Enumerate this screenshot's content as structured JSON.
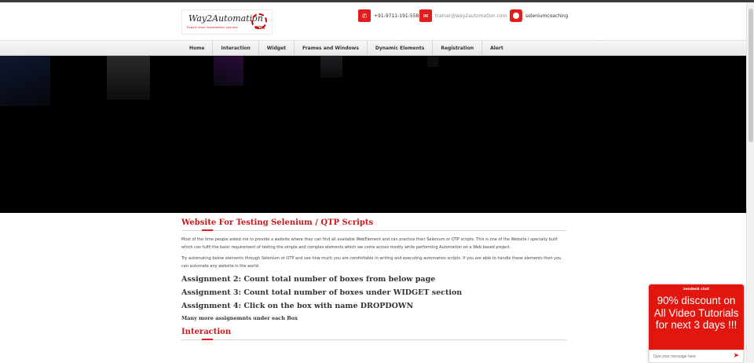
{
  "header": {
    "logo": {
      "brand": "Way2Automation",
      "tagline": "Expert level Automation courses",
      "mark": "W2A"
    },
    "contacts": [
      {
        "icon": "phone-icon",
        "text": "+91-9711-191-558"
      },
      {
        "icon": "envelope-icon",
        "text": "trainer@way2automation.com"
      },
      {
        "icon": "skype-icon",
        "text": "seleniumcoaching"
      }
    ]
  },
  "nav": {
    "items": [
      "Home",
      "Interaction",
      "Widget",
      "Frames and Windows",
      "Dynamic Elements",
      "Registration",
      "Alert"
    ]
  },
  "main": {
    "title": "Website For Testing Selenium / QTP Scripts",
    "para1": "Most of the time people asked me to provide a website where they can find all available WebElement and can practice their Selenium or QTP scripts. This is one of the Website I specially built which can fulfil the basic requirement of testing the simple and complex elements which we come across mostly while performing Automation on a Web based project .",
    "para2": "Try automating below elements through Selenium or QTP and see how much you are comfortable in writing and executing automation scripts. If you are able to handle these elements then you can automate any website in the world.",
    "assignments": [
      "Assignment 2: Count total number of boxes from below page",
      "Assignment 3: Count total number of boxes under WIDGET section",
      "Assignment 4: Click on the box with name DROPDOWN"
    ],
    "note": "Many more assignemnts under each Box",
    "section2_title": "Interaction"
  },
  "chat": {
    "header": "zendesk chat",
    "promo": "90% discount on All Video Tutorials for next 3 days !!!",
    "input_placeholder": "Type your message here"
  },
  "colors": {
    "accent": "#e31d1d",
    "title_red": "#c8191d",
    "hero_bg": "#000000"
  }
}
